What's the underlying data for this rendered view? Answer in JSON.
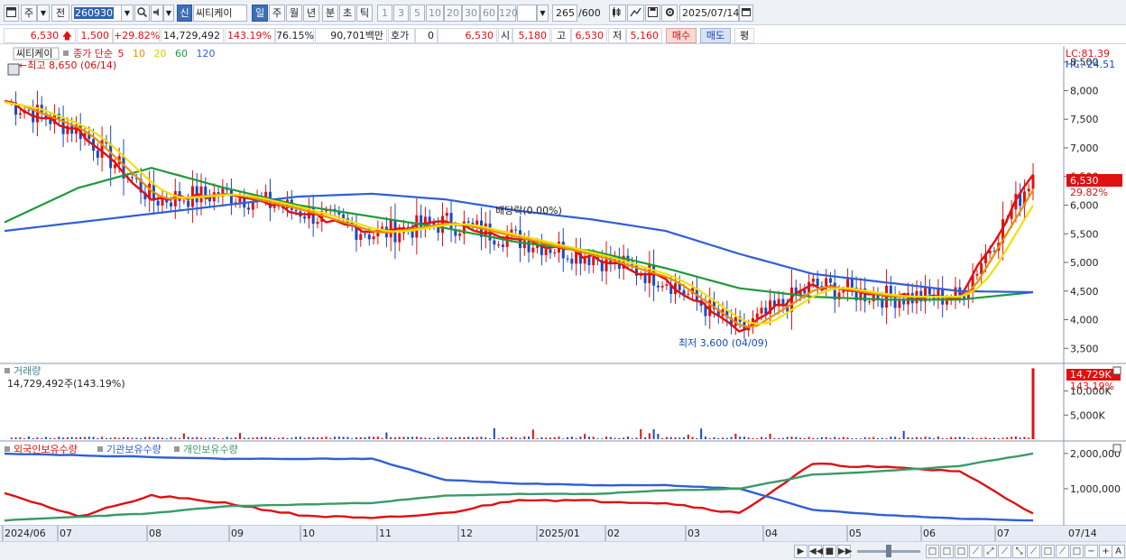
{
  "toolbar": {
    "period_type": "주",
    "prev_label": "전",
    "stock_code": "260930",
    "new_label": "신",
    "stock_name": "씨티케이",
    "timeframes": [
      "일",
      "주",
      "월",
      "년",
      "분",
      "초",
      "틱"
    ],
    "active_timeframe": "일",
    "intervals": [
      "1",
      "3",
      "5",
      "10",
      "20",
      "30",
      "60",
      "120"
    ],
    "count_current": "265",
    "count_max": "/600",
    "date": "2025/07/14"
  },
  "quote": {
    "price": "6,530",
    "change": "1,500",
    "change_pct": "+29.82%",
    "volume": "14,729,492",
    "volume_ratio": "143.19%",
    "turnover_ratio": "76.15%",
    "trade_value": "90,701백만",
    "hoga_label": "호가",
    "hoga_value": "0",
    "hoga_price": "6,530",
    "open_label": "시",
    "open": "5,180",
    "high_label": "고",
    "high": "6,530",
    "low_label": "저",
    "low": "5,160",
    "buy_label": "매수",
    "sell_label": "매도",
    "eval_label": "평"
  },
  "price_panel": {
    "stock_label": "씨티케이",
    "ma_title": "종가 단순",
    "ma_periods": [
      "5",
      "10",
      "20",
      "60",
      "120"
    ],
    "high_note": "←최고 8,650 (06/14)",
    "low_note": "최저 3,600 (04/09)",
    "dividend_note": "배당락(0.00%)",
    "lc": "LC:81.39",
    "hc": "HC:-24.51",
    "last_price": "6,530",
    "last_pct": "29.82%",
    "y_ticks": [
      "8,500",
      "8,000",
      "7,500",
      "7,000",
      "6,500",
      "6,000",
      "5,500",
      "5,000",
      "4,500",
      "4,000",
      "3,500"
    ]
  },
  "volume_panel": {
    "title": "거래량",
    "value_text": "14,729,492주(143.19%)",
    "last_volume": "14,729K",
    "last_pct": "143.19%",
    "y_ticks": [
      "10,000K",
      "5,000K"
    ]
  },
  "holdings_panel": {
    "series": [
      "외국인보유수량",
      "기관보유수량",
      "개인보유수량"
    ],
    "y_ticks": [
      "2,000,000",
      "1,000,000"
    ]
  },
  "x_labels": [
    "2024/06",
    "07",
    "08",
    "09",
    "10",
    "11",
    "12",
    "2025/01",
    "02",
    "03",
    "04",
    "05",
    "06",
    "07",
    "07/14"
  ],
  "colors": {
    "up": "#e01010",
    "down": "#1a48c8",
    "ma5": "#e01010",
    "ma10": "#f08c00",
    "ma20": "#f0e000",
    "ma60": "#1e9a3a",
    "ma120": "#2f5fd8",
    "foreign": "#e01010",
    "institution": "#2f5fd8",
    "individual": "#3a9a6a"
  },
  "chart_data": [
    {
      "type": "line",
      "title": "씨티케이",
      "x": [
        "2024/06",
        "07",
        "08",
        "09",
        "10",
        "11",
        "12",
        "2025/01",
        "02",
        "03",
        "04",
        "05",
        "06",
        "07",
        "07/14"
      ],
      "series": [
        {
          "name": "종가 단순 5",
          "values": [
            7800,
            7300,
            6100,
            6200,
            5900,
            5500,
            5700,
            5400,
            5100,
            4700,
            3800,
            4600,
            4400,
            4400,
            6530
          ]
        },
        {
          "name": "60",
          "values": [
            5700,
            6300,
            6650,
            6300,
            6000,
            5800,
            5600,
            5350,
            5200,
            4900,
            4550,
            4400,
            4350,
            4350,
            4480
          ]
        },
        {
          "name": "120",
          "values": [
            5550,
            5700,
            5850,
            6000,
            6150,
            6200,
            6100,
            5900,
            5750,
            5550,
            5150,
            4800,
            4650,
            4500,
            4480
          ]
        }
      ],
      "ylim": [
        3300,
        8700
      ]
    },
    {
      "type": "bar",
      "title": "거래량",
      "values_note": "last bar",
      "categories": [
        "2025/07/14"
      ],
      "values": [
        14729492
      ]
    },
    {
      "type": "line",
      "x": [
        "2024/06",
        "07",
        "08",
        "09",
        "10",
        "11",
        "12",
        "2025/01",
        "02",
        "03",
        "04",
        "05",
        "06",
        "07",
        "07/14"
      ],
      "series": [
        {
          "name": "외국인보유수량",
          "values": [
            900000,
            200000,
            800000,
            600000,
            250000,
            150000,
            300000,
            700000,
            650000,
            600000,
            300000,
            1700000,
            1600000,
            1500000,
            300000
          ]
        },
        {
          "name": "기관보유수량",
          "values": [
            2000000,
            1950000,
            1900000,
            1850000,
            1850000,
            1850000,
            1250000,
            1150000,
            1100000,
            1100000,
            1000000,
            400000,
            250000,
            150000,
            100000
          ]
        },
        {
          "name": "개인보유수량",
          "values": [
            100000,
            200000,
            300000,
            500000,
            550000,
            600000,
            800000,
            850000,
            850000,
            950000,
            1000000,
            1400000,
            1500000,
            1650000,
            2000000
          ]
        }
      ],
      "ylim": [
        0,
        2100000
      ]
    }
  ]
}
